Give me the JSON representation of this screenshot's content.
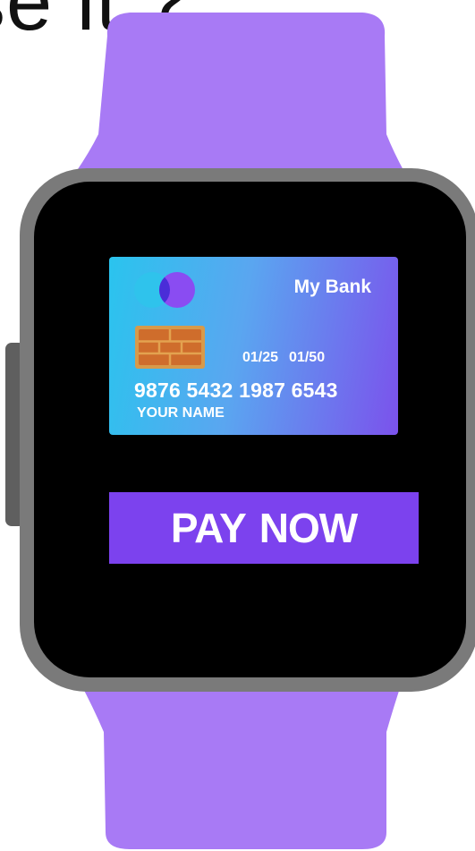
{
  "heading": {
    "partial_text": "se it ?"
  },
  "watch": {
    "strap_color": "#a87af5",
    "bezel_color": "#7a7a7a",
    "screen_color": "#000000"
  },
  "card": {
    "bank_name": "My Bank",
    "logo_icon": "card-network-logo-icon",
    "chip_icon": "card-chip-icon",
    "valid_from": "01/25",
    "valid_thru": "01/50",
    "number": "9876 5432 1987 6543",
    "holder": "YOUR NAME",
    "gradient_start": "#2ac4ee",
    "gradient_end": "#7b52ec"
  },
  "actions": {
    "pay_label": "PAY NOW",
    "pay_color": "#7c42ee"
  }
}
